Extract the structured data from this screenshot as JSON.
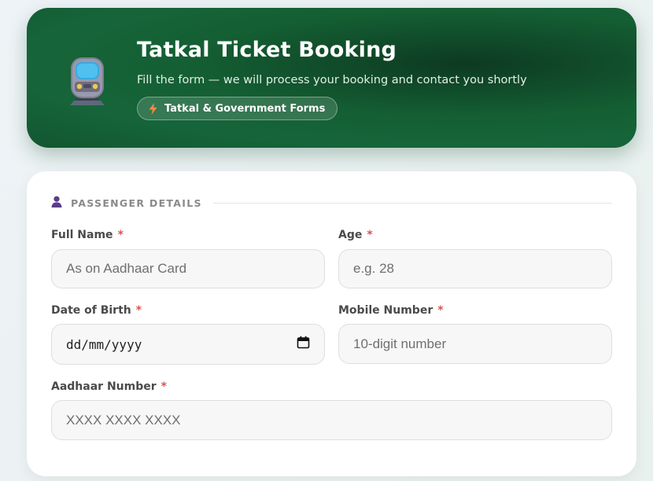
{
  "header": {
    "title": "Tatkal Ticket Booking",
    "subtitle": "Fill the form — we will process your booking and contact you shortly",
    "badge_label": "Tatkal & Government Forms",
    "icon": "train-icon",
    "badge_icon": "lightning-icon"
  },
  "section": {
    "title": "PASSENGER DETAILS",
    "icon": "person-icon"
  },
  "fields": {
    "full_name": {
      "label": "Full Name",
      "required": "*",
      "placeholder": "As on Aadhaar Card"
    },
    "age": {
      "label": "Age",
      "required": "*",
      "placeholder": "e.g. 28"
    },
    "dob": {
      "label": "Date of Birth",
      "required": "*",
      "placeholder": "dd/mm/yyyy"
    },
    "mobile": {
      "label": "Mobile Number",
      "required": "*",
      "placeholder": "10-digit number"
    },
    "aadhaar": {
      "label": "Aadhaar Number",
      "required": "*",
      "placeholder": "XXXX XXXX XXXX"
    }
  },
  "colors": {
    "header_green": "#145f33",
    "required_red": "#d9534f",
    "section_icon": "#5a3d8a"
  }
}
